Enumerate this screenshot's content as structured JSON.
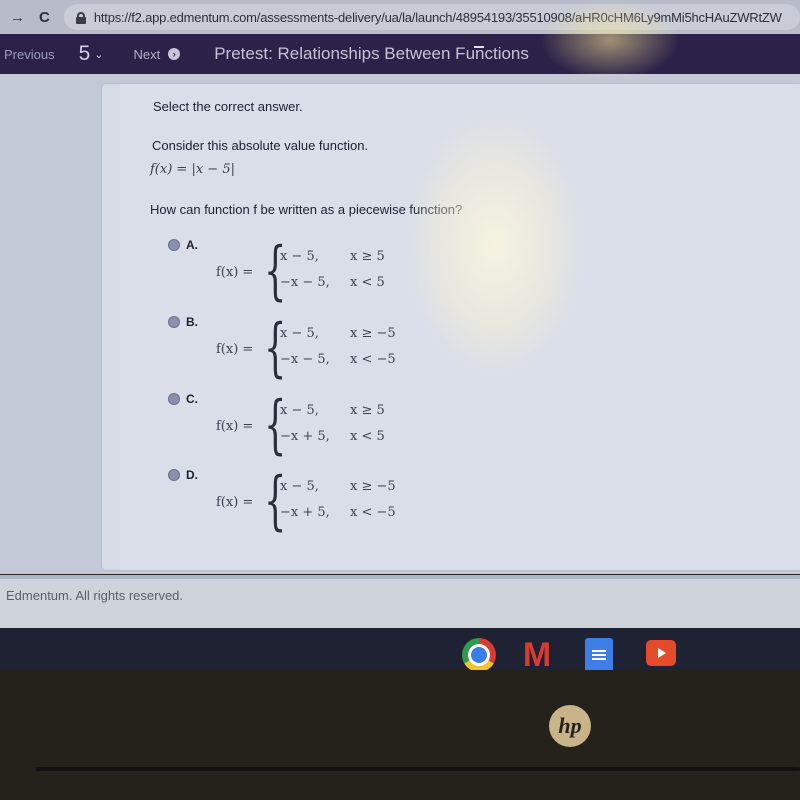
{
  "browser": {
    "back_icon": "arrow-right-icon",
    "reload_icon": "reload-icon",
    "lock_icon": "lock-icon",
    "url": "https://f2.app.edmentum.com/assessments-delivery/ua/la/launch/48954193/35510908/aHR0cHM6Ly9mMi5hcHAuZWRtZW"
  },
  "header": {
    "previous_label": "Previous",
    "question_number": "5",
    "next_label": "Next",
    "title": "Pretest: Relationships Between Functions",
    "background_color": "#2c2249"
  },
  "question": {
    "prompt": "Select the correct answer.",
    "stem": "Consider this absolute value function.",
    "function": "f(x)  =  |x − 5|",
    "question_text": "How can function f be written as a piecewise function?",
    "options": [
      {
        "letter": "A.",
        "lhs": "f(x)  =",
        "case1_expr": "x − 5,",
        "case1_cond": "x ≥ 5",
        "case2_expr": "−x − 5,",
        "case2_cond": "x < 5"
      },
      {
        "letter": "B.",
        "lhs": "f(x)  =",
        "case1_expr": "x − 5,",
        "case1_cond": "x ≥ −5",
        "case2_expr": "−x − 5,",
        "case2_cond": "x < −5"
      },
      {
        "letter": "C.",
        "lhs": "f(x)  =",
        "case1_expr": "x − 5,",
        "case1_cond": "x ≥ 5",
        "case2_expr": "−x + 5,",
        "case2_cond": "x < 5"
      },
      {
        "letter": "D.",
        "lhs": "f(x)  =",
        "case1_expr": "x − 5,",
        "case1_cond": "x ≥ −5",
        "case2_expr": "−x + 5,",
        "case2_cond": "x < −5"
      }
    ],
    "brace_glyph": "{"
  },
  "footer": {
    "copyright": "Edmentum. All rights reserved."
  },
  "shelf": {
    "apps": [
      "chrome-icon",
      "gmail-icon",
      "google-docs-icon",
      "youtube-icon"
    ],
    "gmail_glyph": "M"
  },
  "device": {
    "logo": "hp"
  }
}
